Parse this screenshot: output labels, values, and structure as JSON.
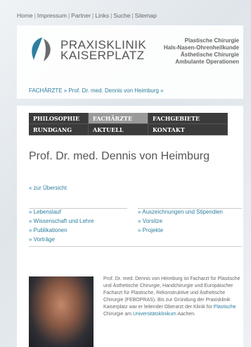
{
  "top_nav": [
    "Home",
    "Impressum",
    "Partner",
    "Links",
    "Suche",
    "Sitemap"
  ],
  "brand": {
    "line1": "PRAXISKLINIK",
    "line2": "KAISERPLATZ"
  },
  "services": [
    "Plastische Chirurgie",
    "Hals-Nasen-Ohrenheilkunde",
    "Ästhetische Chirurgie",
    "Ambulante Operationen"
  ],
  "breadcrumb": "FACHÄRZTE » Prof. Dr. med. Dennis von Heimburg »",
  "menu": [
    {
      "label": "PHILOSOPHIE",
      "active": false
    },
    {
      "label": "FACHÄRZTE",
      "active": true
    },
    {
      "label": "FACHGEBIETE",
      "active": false
    },
    {
      "label": "RUNDGANG",
      "active": false
    },
    {
      "label": "AKTUELL",
      "active": false
    },
    {
      "label": "KONTAKT",
      "active": false
    }
  ],
  "heading": "Prof. Dr. med. Dennis von Heimburg",
  "back_link": "« zur Übersicht",
  "links_left": [
    "» Lebenslauf",
    "» Wissenschaft und Lehre",
    "» Publikationen",
    "» Vorträge"
  ],
  "links_right": [
    "» Auszeichnungen und Stipendien",
    "» Vorsitze",
    "» Projekte"
  ],
  "bio": {
    "text1": "Prof. Dr. med. Dennis von Heimburg ist Facharzt für Plastische und Ästhetische Chirurgie, Handchirurgie und Europäischer Facharzt für Plastische, Rekonstruktive und Ästhetische Chirurgie (FEBOPRAS). Bis zur Gründung der Praxisklinik Kaiserplatz war er leitender Oberarzt der Klinik für ",
    "highlight": "Plastische",
    "text2": " Chirurgie am ",
    "link": "Universitätsklinikum",
    "text3": " Aachen."
  },
  "colors": {
    "link": "#2d7f9f",
    "menu_bg": "#3b3b3b",
    "menu_active": "#9a9a9a"
  }
}
